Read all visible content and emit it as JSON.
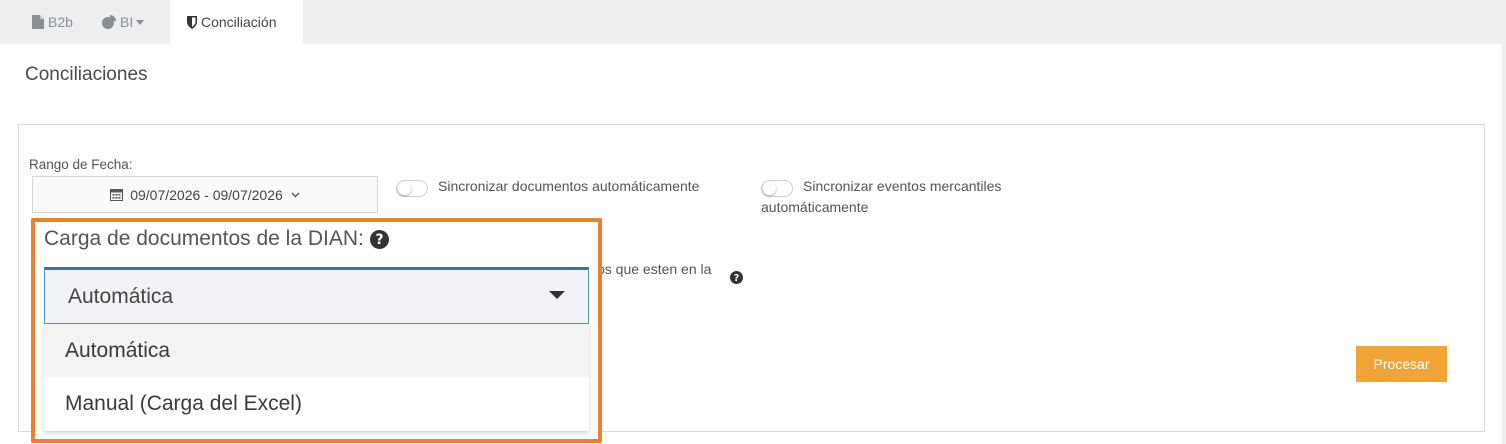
{
  "tabs": [
    {
      "label": "B2b",
      "icon": "file-icon"
    },
    {
      "label": "BI",
      "icon": "pie-chart-icon"
    },
    {
      "label": "Conciliación",
      "icon": "shield-icon"
    }
  ],
  "page": {
    "title": "Conciliaciones"
  },
  "filters": {
    "range_label": "Rango de Fecha:",
    "date_range": "09/07/2026 - 09/07/2026",
    "sync_docs_label": "Sincronizar documentos automáticamente",
    "sync_events_label": "Sincronizar eventos mercantiles automáticamente",
    "partial_text": "os que esten en la"
  },
  "dian": {
    "label": "Carga de documentos de la DIAN:",
    "selected": "Automática",
    "options": [
      "Automática",
      "Manual (Carga del Excel)"
    ]
  },
  "actions": {
    "process_label": "Procesar"
  },
  "colors": {
    "accent": "#f0a436",
    "highlight": "#ee7f2b",
    "select_border": "#4a90d9"
  }
}
